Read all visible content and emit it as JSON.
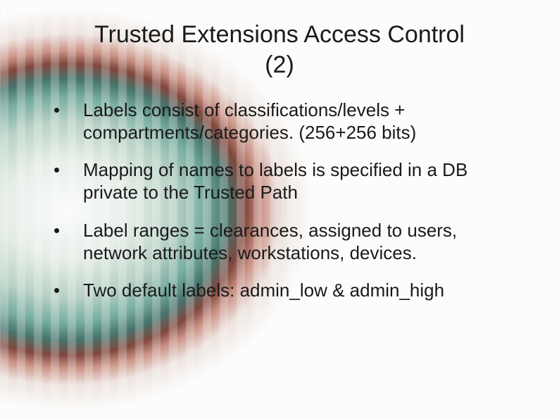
{
  "title_line1": "Trusted Extensions Access Control",
  "title_line2": "(2)",
  "bullets": [
    "Labels consist of classifications/levels + compartments/categories. (256+256 bits)",
    "Mapping of names to labels is specified in a DB private to the Trusted Path",
    "Label ranges = clearances, assigned to users, network attributes, workstations, devices.",
    "Two default labels: admin_low & admin_high"
  ]
}
